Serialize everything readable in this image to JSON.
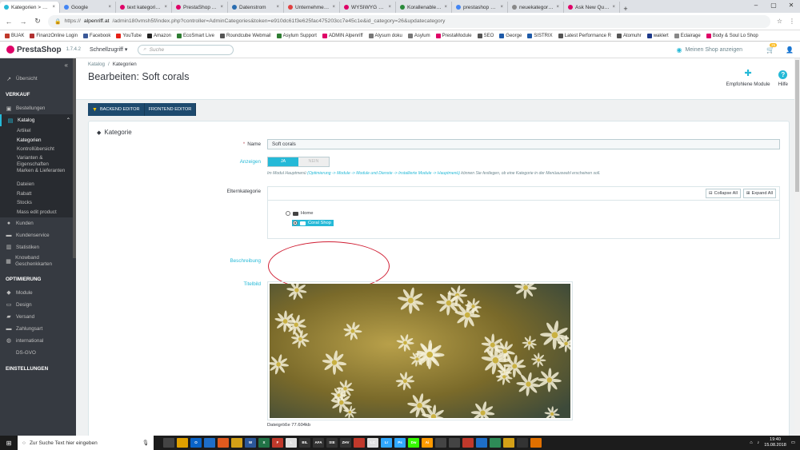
{
  "browser": {
    "tabs": [
      {
        "label": "Kategorien > Bea",
        "color": "#25b9d7",
        "active": true
      },
      {
        "label": "Google",
        "color": "#4285f4"
      },
      {
        "label": "text kategorie - Pr",
        "color": "#df0067"
      },
      {
        "label": "PrestaShop Addon",
        "color": "#df0067"
      },
      {
        "label": "Datenstrom",
        "color": "#2a6db0"
      },
      {
        "label": "Unternehmensser",
        "color": "#e04040"
      },
      {
        "label": "WYSIWYG Koralle",
        "color": "#df0067"
      },
      {
        "label": "Korallenableger u",
        "color": "#2a8a3a"
      },
      {
        "label": "prestashop 1.7 ca",
        "color": "#4285f4"
      },
      {
        "label": "neuekategorie.pn",
        "color": "#888888"
      },
      {
        "label": "Ask New Question",
        "color": "#df0067"
      }
    ],
    "url_host": "alpenriff.at",
    "url_path": "/admin180vmsh5f/index.php?controller=AdminCategories&token=e910dc61f3e625fac475203cc7e45c1e&id_category=26&updatecategory",
    "url_protocol": "https://",
    "bookmarks": [
      {
        "label": "BUAK",
        "color": "#c0392b"
      },
      {
        "label": "FinanzOnline Login",
        "color": "#b03030"
      },
      {
        "label": "Facebook",
        "color": "#3b5998"
      },
      {
        "label": "YouTube",
        "color": "#e62117"
      },
      {
        "label": "Amazon",
        "color": "#222222"
      },
      {
        "label": "EcoSmart Live",
        "color": "#2e7d32"
      },
      {
        "label": "Roundcube Webmail",
        "color": "#555555"
      },
      {
        "label": "Asylum Support",
        "color": "#2e7d32"
      },
      {
        "label": "ADMIN Alpenriff",
        "color": "#df0067"
      },
      {
        "label": "Alysum doku",
        "color": "#777777"
      },
      {
        "label": "Asylum",
        "color": "#777777"
      },
      {
        "label": "PrestaModule",
        "color": "#df0067"
      },
      {
        "label": "SEO",
        "color": "#555555"
      },
      {
        "label": "George",
        "color": "#1e5aa8"
      },
      {
        "label": "SISTRIX",
        "color": "#1e5aa8"
      },
      {
        "label": "Latest Performance R",
        "color": "#555555"
      },
      {
        "label": "Atomuhr",
        "color": "#555555"
      },
      {
        "label": "waklert",
        "color": "#1e3a8a"
      },
      {
        "label": "Eclairage",
        "color": "#888888"
      },
      {
        "label": "Body & Soul Lo Shop",
        "color": "#df0067"
      }
    ]
  },
  "header": {
    "logo": "PrestaShop",
    "version": "1.7.4.2",
    "quick_access": "Schnellzugriff ▾",
    "search_placeholder": "Suche",
    "shop_link": "Meinen Shop anzeigen",
    "notifications": "25"
  },
  "sidebar": {
    "overview": "Übersicht",
    "sections": [
      {
        "title": "VERKAUF"
      },
      {
        "title": "OPTIMIERUNG"
      },
      {
        "title": "EINSTELLUNGEN"
      }
    ],
    "verkauf_items": [
      {
        "label": "Bestellungen",
        "icon": "▣"
      },
      {
        "label": "Katalog",
        "icon": "▤",
        "active": true
      }
    ],
    "katalog_sub": [
      "Artikel",
      "Kategorien",
      "Kontrollübersicht",
      "Varianten & Eigenschaften",
      "Marken & Lieferanten",
      "Dateien",
      "Rabatt",
      "Stocks",
      "Mass edit product"
    ],
    "more_items": [
      {
        "label": "Kunden",
        "icon": "●"
      },
      {
        "label": "Kundenservice",
        "icon": "▬"
      },
      {
        "label": "Statistiken",
        "icon": "▥"
      },
      {
        "label": "Knowband Geschenkkarten",
        "icon": "▦"
      }
    ],
    "opt_items": [
      {
        "label": "Module",
        "icon": "◆"
      },
      {
        "label": "Design",
        "icon": "▭"
      },
      {
        "label": "Versand",
        "icon": "▰"
      },
      {
        "label": "Zahlungsart",
        "icon": "▬"
      },
      {
        "label": "international",
        "icon": "◍"
      },
      {
        "label": "DS-GVO",
        "icon": ""
      }
    ]
  },
  "page": {
    "breadcrumb": [
      "Katalog",
      "Kategorien"
    ],
    "title": "Bearbeiten: Soft corals",
    "toolbar": {
      "modules": "Empfohlene Module",
      "help": "Hilfe"
    },
    "editor": {
      "backend": "BACKEND EDITOR",
      "frontend": "FRONTEND EDITOR"
    }
  },
  "form": {
    "panel_title": "Kategorie",
    "name_label": "Name",
    "name_value": "Soft corals",
    "display_label": "Anzeigen",
    "switch_on": "JA",
    "switch_off": "NEIN",
    "display_help_pre": "Im Modul Hauptmenü ",
    "display_help_link": "(Optimierung -> Module -> Module und Dienste -> Installierte Module -> Hauptmenü)",
    "display_help_post": " können Sie festlegen, ob eine Kategorie in der Menüauswahl erscheinen soll.",
    "parent_label": "Elternkategorie",
    "collapse_all": "Collapse All",
    "expand_all": "Expand All",
    "tree_home": "Home",
    "tree_selected": "Coral Shop",
    "description_label": "Beschreibung",
    "image_label": "Titelbild",
    "filesize": "Dateigröße 77.604kb"
  },
  "taskbar": {
    "search_placeholder": "Zur Suche Text hier eingeben",
    "time": "19:40",
    "date": "15.08.2018",
    "apps": [
      {
        "label": "",
        "color": "#444444"
      },
      {
        "label": "",
        "color": "#e0a000"
      },
      {
        "label": "O",
        "color": "#0a64c8"
      },
      {
        "label": "",
        "color": "#1e6ec8"
      },
      {
        "label": "",
        "color": "#e05a1e"
      },
      {
        "label": "",
        "color": "#d4a017"
      },
      {
        "label": "W",
        "color": "#2b579a"
      },
      {
        "label": "X",
        "color": "#217346"
      },
      {
        "label": "F",
        "color": "#c0392b"
      },
      {
        "label": "L",
        "color": "#e0e0e0"
      },
      {
        "label": "BIL",
        "color": "#333333"
      },
      {
        "label": "AFA",
        "color": "#333333"
      },
      {
        "label": "StE",
        "color": "#333333"
      },
      {
        "label": "ZHV",
        "color": "#333333"
      },
      {
        "label": "",
        "color": "#c0392b"
      },
      {
        "label": "LC",
        "color": "#e0e0e0"
      },
      {
        "label": "Lr",
        "color": "#31a8ff"
      },
      {
        "label": "Ps",
        "color": "#31a8ff"
      },
      {
        "label": "Dw",
        "color": "#35fa00"
      },
      {
        "label": "Ai",
        "color": "#ff9a00"
      },
      {
        "label": "",
        "color": "#444444"
      },
      {
        "label": "",
        "color": "#444444"
      },
      {
        "label": "",
        "color": "#c0392b"
      },
      {
        "label": "",
        "color": "#1e6ec8"
      },
      {
        "label": "",
        "color": "#2e8b57"
      },
      {
        "label": "",
        "color": "#d4a017"
      },
      {
        "label": "",
        "color": "#333333"
      },
      {
        "label": "",
        "color": "#e07000"
      }
    ]
  }
}
